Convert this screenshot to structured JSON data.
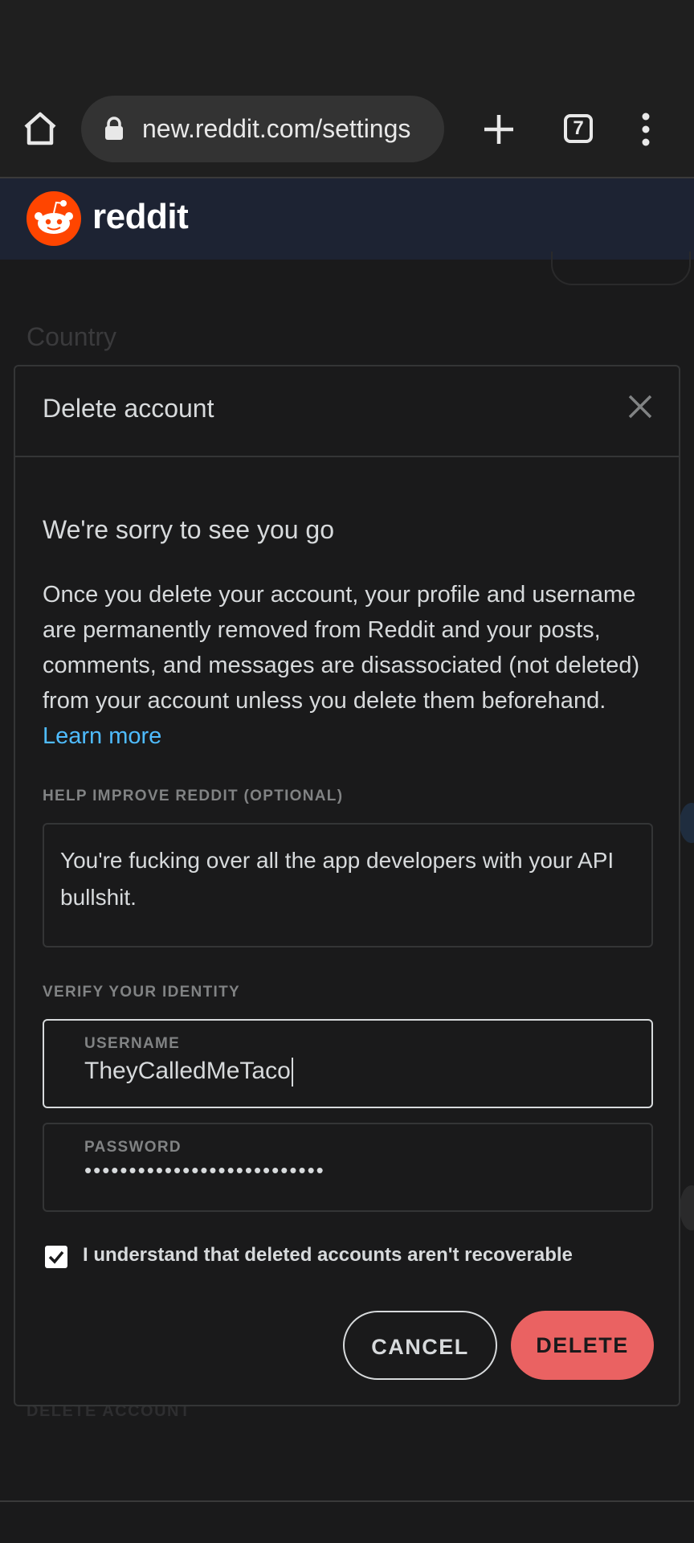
{
  "browser": {
    "url": "new.reddit.com/settings",
    "tab_count": "7"
  },
  "header": {
    "brand": "reddit"
  },
  "background": {
    "country_label": "Country",
    "delete_account_label": "DELETE ACCOUNT"
  },
  "modal": {
    "title": "Delete account",
    "sorry": "We're sorry to see you go",
    "info": "Once you delete your account, your profile and username are permanently removed from Reddit and your posts, comments, and messages are disassociated (not deleted) from your account unless you delete them beforehand.",
    "learn_more": "Learn more",
    "feedback_label": "HELP IMPROVE REDDIT (OPTIONAL)",
    "feedback_value": "You're fucking over all the app developers with your API bullshit.",
    "verify_label": "VERIFY YOUR IDENTITY",
    "username_label": "USERNAME",
    "username_value": "TheyCalledMeTaco",
    "password_label": "PASSWORD",
    "password_value": "•••••••••••••••••••••••••••",
    "checkbox_label": "I understand that deleted accounts aren't recoverable",
    "cancel_label": "CANCEL",
    "delete_label": "DELETE"
  },
  "colors": {
    "accent_delete": "#ea6262",
    "link": "#4fbcff",
    "brand_orange": "#ff4500"
  }
}
